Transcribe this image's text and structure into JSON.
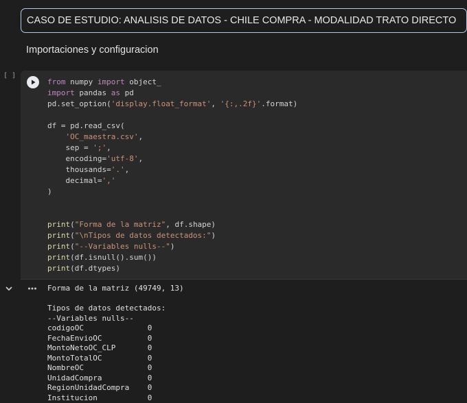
{
  "title_cell": {
    "text": "CASO DE ESTUDIO: ANALISIS DE DATOS - CHILE COMPRA - MODALIDAD TRATO DIRECTO"
  },
  "section_heading": "Importaciones y configuracion",
  "code_cell": {
    "execution_count": "[ ]",
    "lines": [
      [
        [
          "kw",
          "from"
        ],
        [
          "var",
          " numpy "
        ],
        [
          "kw",
          "import"
        ],
        [
          "var",
          " object_"
        ]
      ],
      [
        [
          "kw",
          "import"
        ],
        [
          "var",
          " pandas "
        ],
        [
          "kw",
          "as"
        ],
        [
          "var",
          " pd"
        ]
      ],
      [
        [
          "var",
          "pd.set_option("
        ],
        [
          "str",
          "'display.float_format'"
        ],
        [
          "var",
          ", "
        ],
        [
          "str",
          "'{:,.2f}'"
        ],
        [
          "var",
          ".format)"
        ]
      ],
      [],
      [
        [
          "var",
          "df = pd.read_csv("
        ]
      ],
      [
        [
          "var",
          "    "
        ],
        [
          "str",
          "'OC_maestra.csv'"
        ],
        [
          "var",
          ","
        ]
      ],
      [
        [
          "var",
          "    sep = "
        ],
        [
          "str",
          "';'"
        ],
        [
          "var",
          ","
        ]
      ],
      [
        [
          "var",
          "    encoding="
        ],
        [
          "str",
          "'utf-8'"
        ],
        [
          "var",
          ","
        ]
      ],
      [
        [
          "var",
          "    thousands="
        ],
        [
          "str",
          "'.'"
        ],
        [
          "var",
          ","
        ]
      ],
      [
        [
          "var",
          "    decimal="
        ],
        [
          "str",
          "','"
        ]
      ],
      [
        [
          "var",
          ")"
        ]
      ],
      [],
      [],
      [
        [
          "fn",
          "print"
        ],
        [
          "var",
          "("
        ],
        [
          "str",
          "\"Forma de la matriz\""
        ],
        [
          "var",
          ", df.shape)"
        ]
      ],
      [
        [
          "fn",
          "print"
        ],
        [
          "var",
          "("
        ],
        [
          "str",
          "\"\\nTipos de datos detectados:\""
        ],
        [
          "var",
          ")"
        ]
      ],
      [
        [
          "fn",
          "print"
        ],
        [
          "var",
          "("
        ],
        [
          "str",
          "\"--Variables nulls--\""
        ],
        [
          "var",
          ")"
        ]
      ],
      [
        [
          "fn",
          "print"
        ],
        [
          "var",
          "(df.isnull().sum())"
        ]
      ],
      [
        [
          "fn",
          "print"
        ],
        [
          "var",
          "(df.dtypes)"
        ]
      ]
    ]
  },
  "output": {
    "lines": [
      "Forma de la matriz (49749, 13)",
      "",
      "Tipos de datos detectados:",
      "--Variables nulls--",
      "codigoOC              0",
      "FechaEnvioOC          0",
      "MontoNetoOC_CLP       0",
      "MontoTotalOC          0",
      "NombreOC              0",
      "UnidadCompra          0",
      "RegionUnidadCompra    0",
      "Institucion           0"
    ]
  },
  "icons": {
    "run": "play-icon",
    "collapse": "chevron-down-icon",
    "output_menu": "more-horiz-icon"
  }
}
